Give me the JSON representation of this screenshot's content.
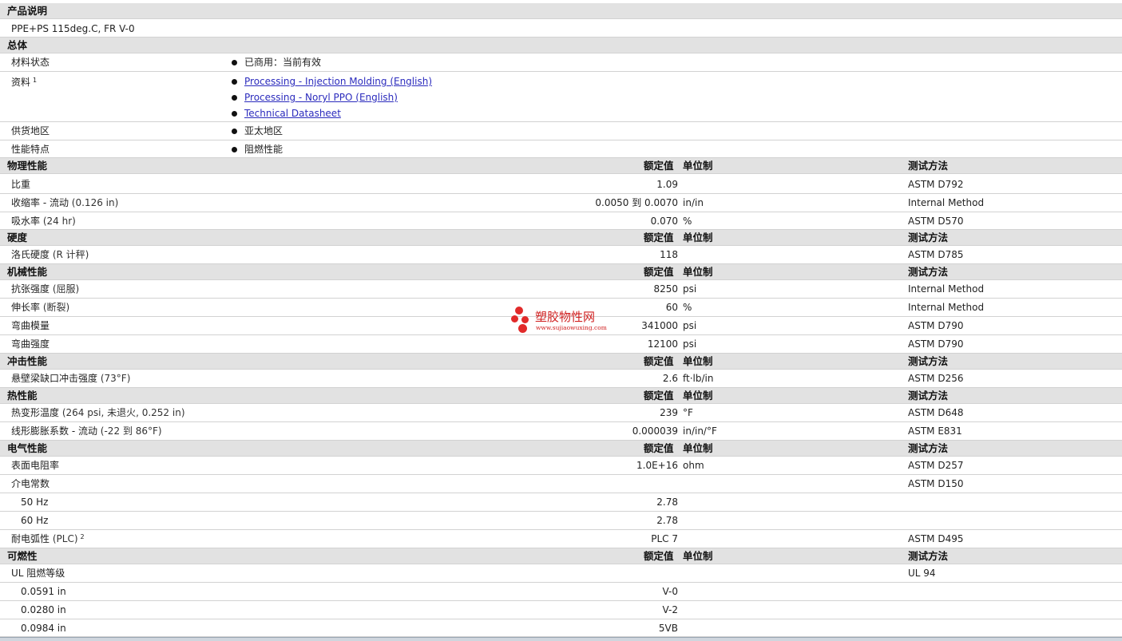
{
  "product_desc": {
    "title": "产品说明",
    "text": "PPE+PS 115deg.C, FR V-0"
  },
  "general": {
    "title": "总体",
    "material_status": {
      "label": "材料状态",
      "value": "已商用：当前有效"
    },
    "docs": {
      "label": "资料",
      "sup": "1",
      "links": [
        "Processing - Injection Molding (English)",
        "Processing - Noryl PPO (English)",
        "Technical Datasheet"
      ]
    },
    "region": {
      "label": "供货地区",
      "value": "亚太地区"
    },
    "features": {
      "label": "性能特点",
      "value": "阻燃性能"
    }
  },
  "headers": {
    "nominal": "额定值",
    "unit": "单位制",
    "method": "测试方法"
  },
  "sections": {
    "physical": {
      "title": "物理性能",
      "rows": [
        {
          "label": "比重",
          "cond": "",
          "value": "1.09",
          "unit": "",
          "method": "ASTM D792"
        },
        {
          "label": "收缩率 - 流动",
          "cond": "(0.126 in)",
          "value": "0.0050 到 0.0070",
          "unit": "in/in",
          "method": "Internal Method"
        },
        {
          "label": "吸水率",
          "cond": "(24 hr)",
          "value": "0.070",
          "unit": "%",
          "method": "ASTM D570"
        }
      ]
    },
    "hardness": {
      "title": "硬度",
      "rows": [
        {
          "label": "洛氏硬度",
          "cond": "(R 计秤)",
          "value": "118",
          "unit": "",
          "method": "ASTM D785"
        }
      ]
    },
    "mechanical": {
      "title": "机械性能",
      "rows": [
        {
          "label": "抗张强度",
          "cond": "(屈服)",
          "value": "8250",
          "unit": "psi",
          "method": "Internal Method"
        },
        {
          "label": "伸长率",
          "cond": "(断裂)",
          "value": "60",
          "unit": "%",
          "method": "Internal Method"
        },
        {
          "label": "弯曲模量",
          "cond": "",
          "value": "341000",
          "unit": "psi",
          "method": "ASTM D790"
        },
        {
          "label": "弯曲强度",
          "cond": "",
          "value": "12100",
          "unit": "psi",
          "method": "ASTM D790"
        }
      ]
    },
    "impact": {
      "title": "冲击性能",
      "rows": [
        {
          "label": "悬壁梁缺口冲击强度",
          "cond": "(73°F)",
          "value": "2.6",
          "unit": "ft·lb/in",
          "method": "ASTM D256"
        }
      ]
    },
    "thermal": {
      "title": "热性能",
      "rows": [
        {
          "label": "热变形温度",
          "cond": "(264 psi, 未退火, 0.252 in)",
          "value": "239",
          "unit": "°F",
          "method": "ASTM D648"
        },
        {
          "label": "线形膨胀系数 - 流动",
          "cond": "(-22 到 86°F)",
          "value": "0.000039",
          "unit": "in/in/°F",
          "method": "ASTM E831"
        }
      ]
    },
    "electrical": {
      "title": "电气性能",
      "rows": [
        {
          "label": "表面电阻率",
          "cond": "",
          "value": "1.0E+16",
          "unit": "ohm",
          "method": "ASTM D257"
        },
        {
          "label": "介电常数",
          "cond": "",
          "value": "",
          "unit": "",
          "method": "ASTM D150"
        },
        {
          "label": "50 Hz",
          "cond": "",
          "value": "2.78",
          "unit": "",
          "method": ""
        },
        {
          "label": "60 Hz",
          "cond": "",
          "value": "2.78",
          "unit": "",
          "method": ""
        },
        {
          "label": "耐电弧性",
          "cond": "(PLC)",
          "sup": "2",
          "value": "PLC 7",
          "unit": "",
          "method": "ASTM D495"
        }
      ]
    },
    "flammability": {
      "title": "可燃性",
      "rows": [
        {
          "label": "UL 阻燃等级",
          "cond": "",
          "value": "",
          "unit": "",
          "method": "UL 94"
        },
        {
          "label": "0.0591 in",
          "cond": "",
          "value": "V-0",
          "unit": "",
          "method": ""
        },
        {
          "label": "0.0280 in",
          "cond": "",
          "value": "V-2",
          "unit": "",
          "method": ""
        },
        {
          "label": "0.0984 in",
          "cond": "",
          "value": "5VB",
          "unit": "",
          "method": ""
        }
      ]
    }
  },
  "watermark": {
    "title": "塑胶物性网",
    "url": "www.sujiaowuxing.com"
  },
  "colors": {
    "section_bg": "#e2e2e2",
    "link": "#2b2bbd",
    "watermark": "#e12a2a"
  }
}
